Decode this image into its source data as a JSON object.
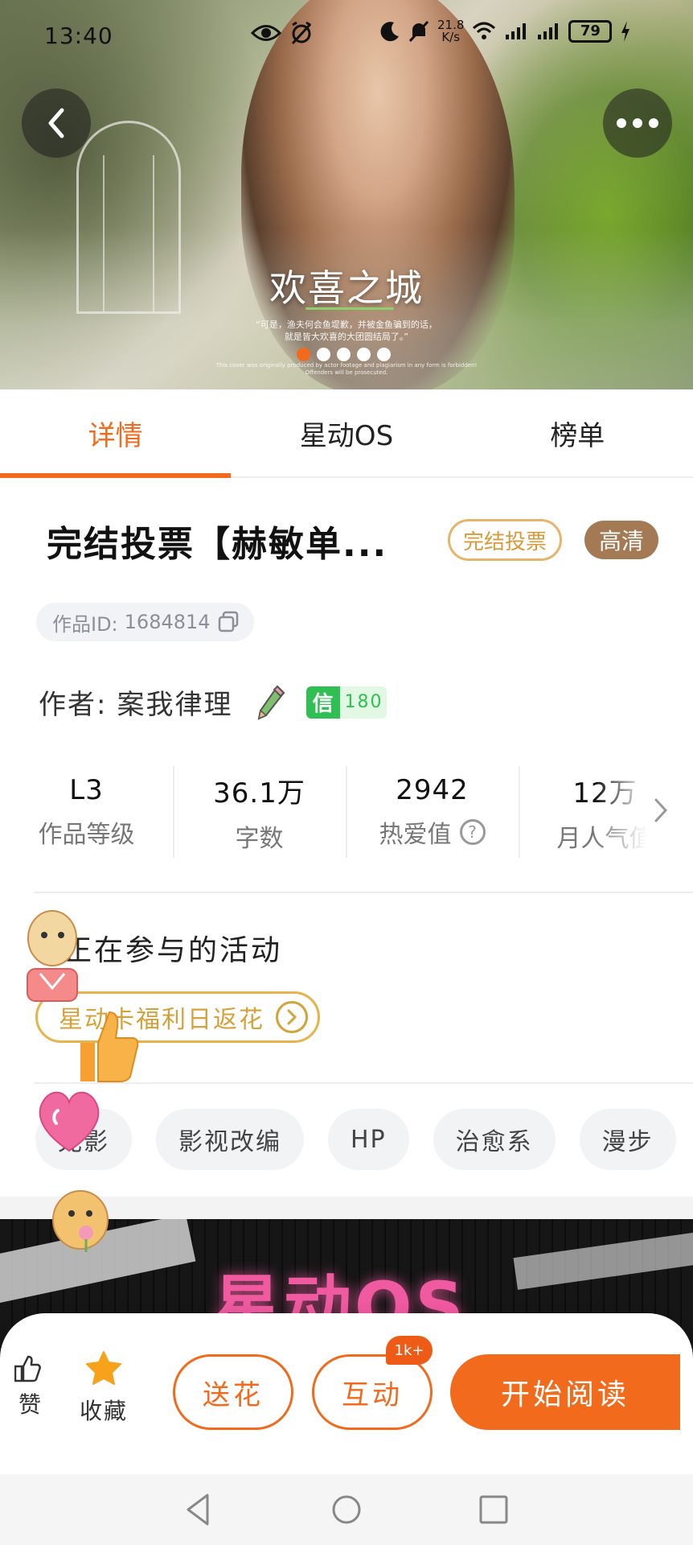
{
  "status_bar": {
    "time": "13:40",
    "speed_value": "21.8",
    "speed_unit": "K/s",
    "battery": "79"
  },
  "banner": {
    "title": "欢喜之城",
    "caption_line1": "“可是，渔夫何会鱼堤歉，并被金鱼骗到的话，",
    "caption_line2": "就是皆大欢喜的大团圆结局了。”",
    "fine_print_line1": "This cover was originally produced by actor footage and plagiarism in any form is forbidden!",
    "fine_print_line2": "Offenders will be prosecuted.",
    "slide_count": 5,
    "active_slide": 0
  },
  "tabs": [
    {
      "label": "详情",
      "active": true
    },
    {
      "label": "星动OS",
      "active": false
    },
    {
      "label": "榜单",
      "active": false
    }
  ],
  "work": {
    "title": "完结投票【赫敏单...",
    "badge_vote": "完结投票",
    "badge_hd": "高清",
    "id_label": "作品ID:",
    "id_value": "1684814"
  },
  "author": {
    "label": "作者:",
    "name": "案我律理",
    "credit_mark": "信",
    "credit_value": "180"
  },
  "stats": [
    {
      "value": "L3",
      "label": "作品等级"
    },
    {
      "value": "36.1万",
      "label": "字数"
    },
    {
      "value": "2942",
      "label": "热爱值"
    },
    {
      "value": "12万",
      "label": "月人气值"
    }
  ],
  "activity": {
    "section_title": "正在参与的活动",
    "item": "星动卡福利日返花"
  },
  "tags": [
    "光影",
    "影视改编",
    "HP",
    "治愈系",
    "漫步"
  ],
  "promo": {
    "text": "星动OS"
  },
  "action_bar": {
    "like_label": "赞",
    "fav_label": "收藏",
    "flower_label": "送花",
    "interact_label": "互动",
    "interact_badge": "1k+",
    "read_label": "开始阅读"
  },
  "colors": {
    "accent": "#f26a1b",
    "gold": "#e6b34d",
    "hd_badge": "#a37a53",
    "credit_green": "#2fbf52"
  }
}
